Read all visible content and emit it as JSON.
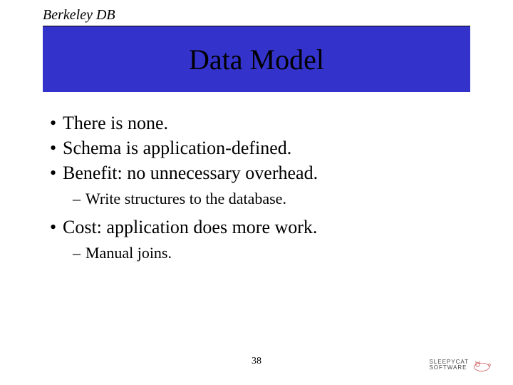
{
  "header": {
    "label": "Berkeley DB"
  },
  "title": "Data Model",
  "bullets": [
    {
      "text": "There is none."
    },
    {
      "text": "Schema is application-defined."
    },
    {
      "text": "Benefit: no unnecessary overhead.",
      "sub": [
        "Write structures to the database."
      ]
    },
    {
      "text": "Cost: application does more work.",
      "sub": [
        "Manual joins."
      ]
    }
  ],
  "page_number": "38",
  "logo": {
    "line1": "SLEEPYCAT",
    "line2": "SOFTWARE"
  }
}
